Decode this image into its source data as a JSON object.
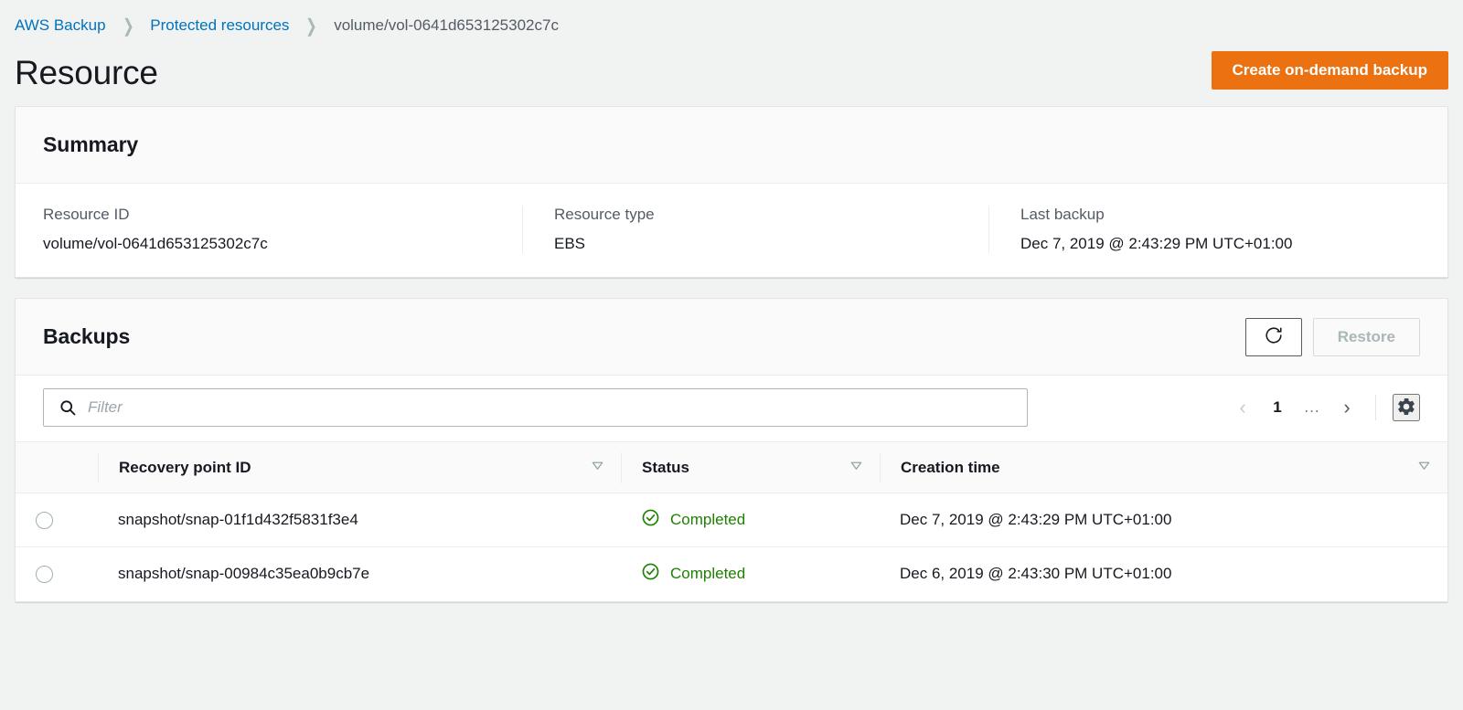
{
  "breadcrumb": {
    "items": [
      {
        "label": "AWS Backup",
        "type": "link"
      },
      {
        "label": "Protected resources",
        "type": "link"
      },
      {
        "label": "volume/vol-0641d653125302c7c",
        "type": "current"
      }
    ],
    "separator": "❯"
  },
  "header": {
    "title": "Resource",
    "primary_action": "Create on-demand backup",
    "primary_action_color": "#ec7211"
  },
  "summary": {
    "title": "Summary",
    "fields": [
      {
        "label": "Resource ID",
        "value": "volume/vol-0641d653125302c7c"
      },
      {
        "label": "Resource type",
        "value": "EBS"
      },
      {
        "label": "Last backup",
        "value": "Dec 7, 2019 @ 2:43:29 PM UTC+01:00"
      }
    ]
  },
  "backups": {
    "title": "Backups",
    "refresh_label": "refresh-icon",
    "restore_label": "Restore",
    "restore_disabled": true,
    "filter": {
      "placeholder": "Filter",
      "value": "",
      "icon": "search-icon"
    },
    "pagination": {
      "prev": "‹",
      "prev_disabled": true,
      "current_page": "1",
      "ellipsis": "...",
      "next": "›",
      "settings_icon": "gear-icon"
    },
    "columns": [
      {
        "label": "Recovery point ID",
        "sortable": true
      },
      {
        "label": "Status",
        "sortable": true
      },
      {
        "label": "Creation time",
        "sortable": true
      }
    ],
    "rows": [
      {
        "selected": false,
        "recovery_point_id": "snapshot/snap-01f1d432f5831f3e4",
        "status": "Completed",
        "status_color": "#1d8102",
        "creation_time": "Dec 7, 2019 @ 2:43:29 PM UTC+01:00"
      },
      {
        "selected": false,
        "recovery_point_id": "snapshot/snap-00984c35ea0b9cb7e",
        "status": "Completed",
        "status_color": "#1d8102",
        "creation_time": "Dec 6, 2019 @ 2:43:30 PM UTC+01:00"
      }
    ]
  }
}
